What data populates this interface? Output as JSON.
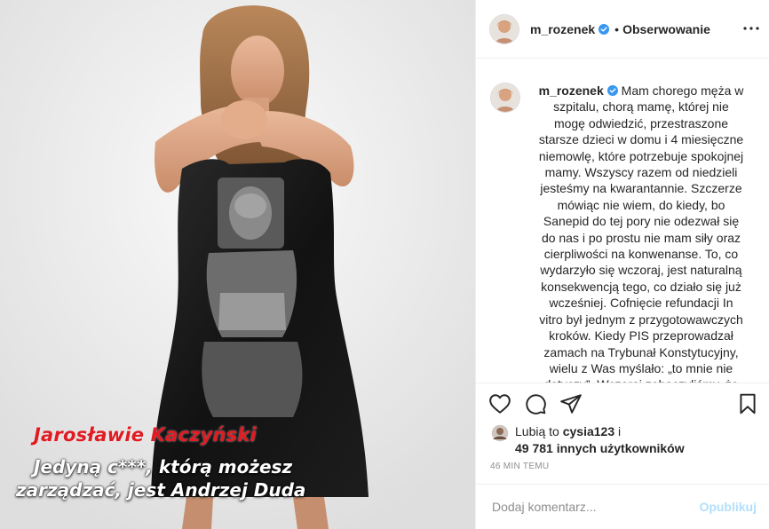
{
  "post": {
    "username": "m_rozenek",
    "header_separator": "•",
    "follow_label": "Obserwowanie",
    "overlay": {
      "title": "Jarosławie Kaczyński",
      "line1": "Jedyną c***, którą możesz",
      "line2": "zarządzać, jest Andrzej Duda"
    },
    "caption": {
      "username": "m_rozenek",
      "text": "Mam chorego męża w szpitalu, chorą mamę, której nie mogę odwiedzić, przestraszone starsze dzieci w domu i 4 miesięczne niemowlę, które potrzebuje spokojnej mamy. Wszyscy razem od niedzieli jesteśmy na kwarantannie. Szczerze mówiąc nie wiem, do kiedy, bo Sanepid do tej pory nie odezwał się do nas i po prostu nie mam siły oraz cierpliwości na konwenanse. To, co wydarzyło się wczoraj, jest naturalną konsekwencją tego, co działo się już wcześniej. Cofnięcie refundacji In vitro był jednym z przygotowawczych kroków. Kiedy PIS przeprowadzał zamach na Trybunał Konstytucyjny, wielu z Was myślało: „to mnie nie dotyczy”. Wczoraj zobaczyliśmy, że"
    },
    "likes": {
      "prefix": "Lubią to",
      "first_user": "cysia123",
      "joiner": "i",
      "others": "49 781 innych użytkowników"
    },
    "timestamp": "46 MIN TEMU",
    "comment": {
      "placeholder": "Dodaj komentarz...",
      "publish_label": "Opublikuj"
    }
  },
  "colors": {
    "verified": "#3897f0",
    "overlay_title": "#e01b22",
    "publish_disabled": "#b2dffc",
    "border": "#efefef"
  },
  "icons": [
    "heart-icon",
    "comment-icon",
    "share-icon",
    "bookmark-icon",
    "more-icon",
    "verified-badge-icon"
  ]
}
